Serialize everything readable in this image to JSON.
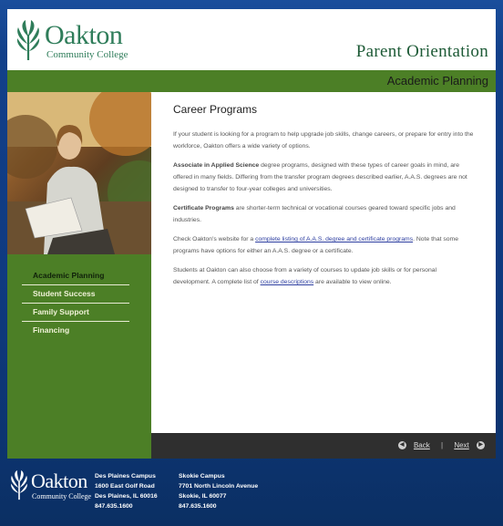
{
  "header": {
    "logo_name": "Oakton",
    "logo_sub": "Community College",
    "title": "Parent Orientation"
  },
  "section_title": "Academic Planning",
  "sidebar": {
    "items": [
      {
        "label": "Academic Planning",
        "active": true
      },
      {
        "label": "Student Success",
        "active": false
      },
      {
        "label": "Family Support",
        "active": false
      },
      {
        "label": "Financing",
        "active": false
      }
    ]
  },
  "content": {
    "heading": "Career Programs",
    "p1": "If your student is looking for a program to help upgrade job skills, change careers, or prepare for entry into the workforce, Oakton offers a wide variety of options.",
    "p2_bold": "Associate in Applied Science",
    "p2_rest": " degree programs, designed with these types of career goals in mind, are offered in many fields. Differing from the transfer program degrees described earlier, A.A.S. degrees are not designed to transfer to four-year colleges and universities.",
    "p3_bold": "Certificate Programs",
    "p3_rest": " are shorter-term technical or vocational courses geared toward specific jobs and industries.",
    "p4_pre": "Check Oakton's website for a ",
    "p4_link": "complete listing of A.A.S. degree and certificate programs",
    "p4_post": ". Note that some programs have options for either an A.A.S. degree or a certificate.",
    "p5_pre": "Students at Oakton can also choose from a variety of courses to update job skills or for personal development. A complete list of ",
    "p5_link": "course descriptions",
    "p5_post": " are available to view online."
  },
  "pager": {
    "back": "Back",
    "separator": "|",
    "next": "Next"
  },
  "footer": {
    "logo_name": "Oakton",
    "logo_sub": "Community College",
    "campuses": [
      {
        "name": "Des Plaines Campus",
        "street": "1600 East Golf Road",
        "city": "Des Plaines, IL 60016",
        "phone": "847.635.1600"
      },
      {
        "name": "Skokie Campus",
        "street": "7701 North Lincoln Avenue",
        "city": "Skokie, IL 60077",
        "phone": "847.635.1600"
      }
    ]
  },
  "colors": {
    "green": "#4c7f26",
    "blue": "#12408a",
    "logo_green": "#2f7d5a",
    "dark_bar": "#2f2f2f"
  }
}
